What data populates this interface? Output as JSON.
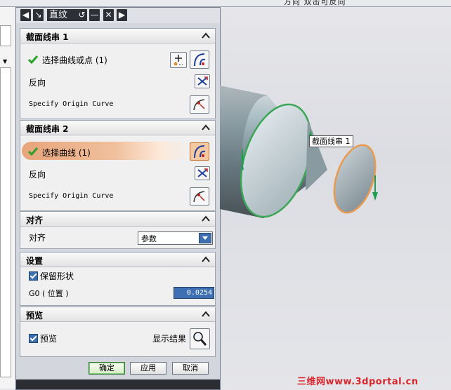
{
  "top_hint": "方向    双击可反向",
  "dialog": {
    "title": "直纹",
    "title_buttons": [
      "◀",
      "↘",
      "↺",
      "—",
      "✕",
      "▶"
    ]
  },
  "section1": {
    "header": "截面线串 1",
    "select_label": "选择曲线或点 (1)",
    "reverse_label": "反向",
    "origin_label": "Specify Origin Curve"
  },
  "section2": {
    "header": "截面线串 2",
    "select_label": "选择曲线 (1)",
    "reverse_label": "反向",
    "origin_label": "Specify Origin Curve"
  },
  "align": {
    "header": "对齐",
    "label": "对齐",
    "value": "参数"
  },
  "settings": {
    "header": "设置",
    "keep_shape": "保留形状",
    "g0_label": "G0 ( 位置 )",
    "g0_value": "0.0254"
  },
  "preview": {
    "header": "预览",
    "preview_label": "预览",
    "show_result": "显示结果"
  },
  "footer": {
    "ok": "确定",
    "apply": "应用",
    "cancel": "取消"
  },
  "viewport": {
    "annotation": "截面线串 1"
  },
  "watermark": "三维网www.3dportal.cn",
  "colors": {
    "accent": "#3d6fb2",
    "selection": "#e7a57b",
    "curve_green": "#3aa655",
    "curve_orange": "#e89a50",
    "watermark": "#d9262c"
  }
}
